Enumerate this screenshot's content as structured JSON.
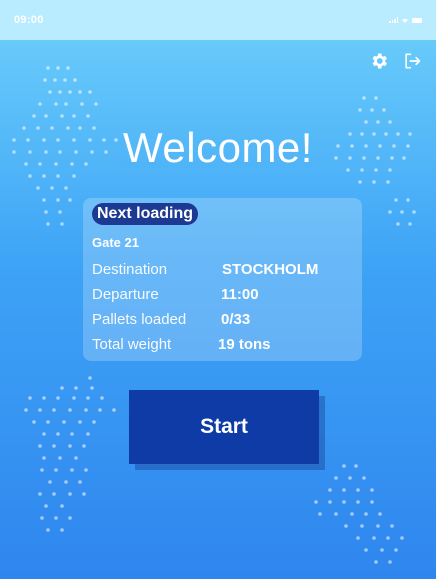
{
  "status_bar": {
    "time": "09:00"
  },
  "header": {
    "settings_icon": "gear-icon",
    "logout_icon": "logout-icon"
  },
  "welcome": {
    "title": "Welcome!"
  },
  "next_loading": {
    "badge": "Next loading",
    "gate": "Gate 21",
    "rows": [
      {
        "label": "Destination",
        "value": "STOCKHOLM"
      },
      {
        "label": "Departure",
        "value": "11:00"
      },
      {
        "label": "Pallets loaded",
        "value": "0/33"
      },
      {
        "label": "Total weight",
        "value": "19 tons"
      }
    ]
  },
  "actions": {
    "start_label": "Start"
  },
  "colors": {
    "background_top": "#6fd1fb",
    "background_bottom": "#2f86ee",
    "button": "#0f3ba6",
    "badge": "#1d3a93"
  }
}
